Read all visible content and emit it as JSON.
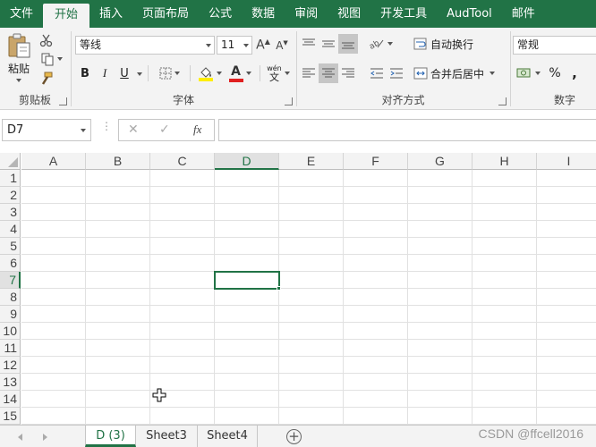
{
  "ribbon_tabs": [
    "文件",
    "开始",
    "插入",
    "页面布局",
    "公式",
    "数据",
    "审阅",
    "视图",
    "开发工具",
    "AudTool",
    "邮件"
  ],
  "active_tab": "开始",
  "clipboard": {
    "paste_label": "粘贴",
    "group_label": "剪贴板"
  },
  "font": {
    "name": "等线",
    "size": "11",
    "group_label": "字体",
    "bold": "B",
    "italic": "I",
    "underline": "U",
    "font_color_glyph": "A",
    "phonetic_top": "wén",
    "phonetic_bottom": "文"
  },
  "alignment": {
    "wrap_text": "自动换行",
    "merge_center": "合并后居中",
    "group_label": "对齐方式"
  },
  "number": {
    "format": "常规",
    "percent": "%",
    "comma": ",",
    "group_label": "数字"
  },
  "formula_bar": {
    "name_box": "D7",
    "cancel": "✕",
    "enter": "✓",
    "fx": "fx",
    "formula": ""
  },
  "columns": [
    "A",
    "B",
    "C",
    "D",
    "E",
    "F",
    "G",
    "H",
    "I"
  ],
  "rows": [
    "1",
    "2",
    "3",
    "4",
    "5",
    "6",
    "7",
    "8",
    "9",
    "10",
    "11",
    "12",
    "13",
    "14",
    "15"
  ],
  "selected_cell": {
    "column": "D",
    "row": "7"
  },
  "sheets": [
    "D (3)",
    "Sheet3",
    "Sheet4"
  ],
  "active_sheet": "D (3)",
  "add_sheet": "+",
  "watermark": "CSDN @ffcell2016",
  "colors": {
    "excel_green": "#217346",
    "ribbon_bg": "#f3f3f3",
    "gridline": "#e1e1e1"
  }
}
